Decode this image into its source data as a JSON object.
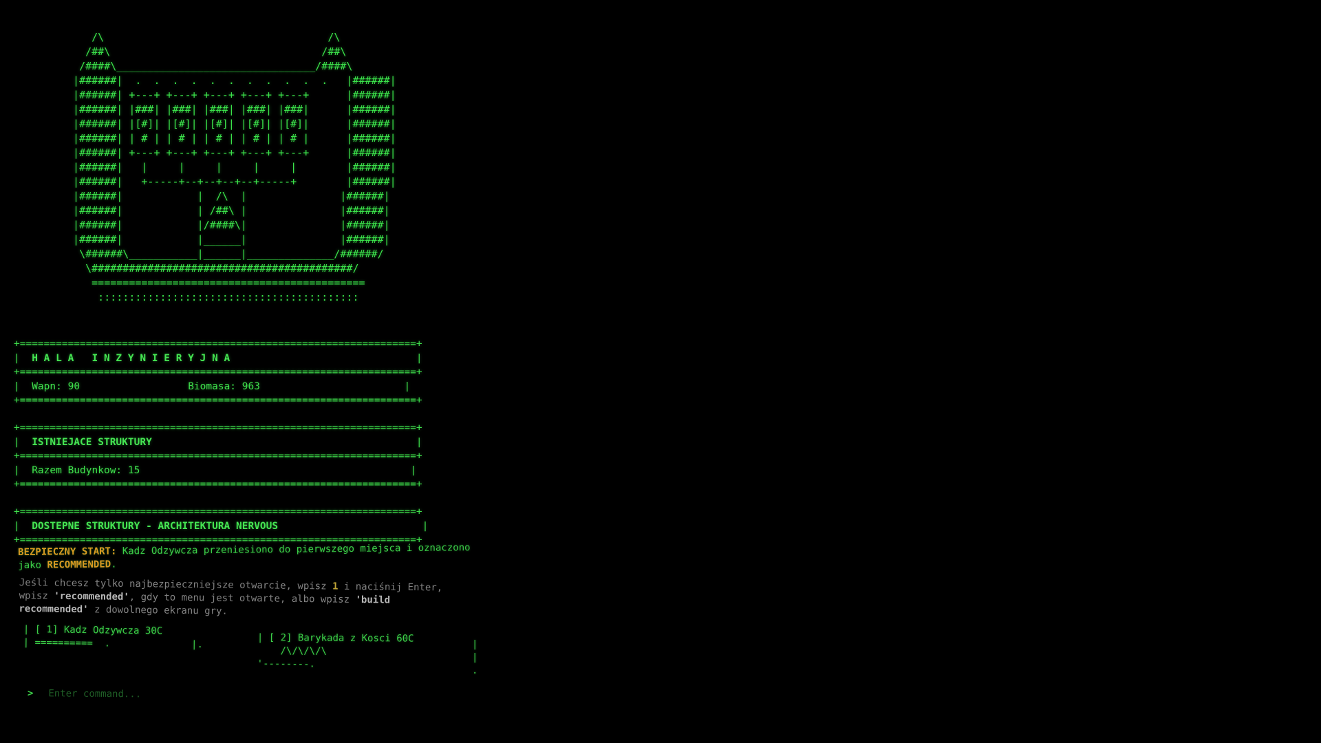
{
  "ascii_art": "     /\\                                    /\\\n    /##\\                                  /##\\\n   /####\\________________________________/####\\\n  |######|  .  .  .  .  .  .  .  .  .  .  .   |######|\n  |######| +---+ +---+ +---+ +---+ +---+      |######|\n  |######| |###| |###| |###| |###| |###|      |######|\n  |######| |[#]| |[#]| |[#]| |[#]| |[#]|      |######|\n  |######| | # | | # | | # | | # | | # |      |######|\n  |######| +---+ +---+ +---+ +---+ +---+      |######|\n  |######|   |     |     |     |     |        |######|\n  |######|   +-----+--+--+--+--+-----+        |######|\n  |######|            |  /\\  |               |######|\n  |######|            | /##\\ |               |######|\n  |######|            |/####\\|               |######|\n  |######|            |______|               |######|\n   \\######\\___________|______|______________/######/\n    \\##########################################/\n     ============================================\n      ::::::::::::::::::::::::::::::::::::::::::",
  "hall": {
    "border": "+==================================================================+",
    "title": "H A L A   I N Z Y N I E R Y J N A",
    "lime_label": "Wapn:",
    "lime_value": "90",
    "biomass_label": "Biomasa:",
    "biomass_value": "963"
  },
  "existing": {
    "title": "ISTNIEJACE STRUKTURY",
    "total_label": "Razem Budynkow:",
    "total_value": "15"
  },
  "available": {
    "title": "DOSTEPNE STRUKTURY - ARCHITEKTURA NERVOUS"
  },
  "safe_start": {
    "label": "BEZPIECZNY START:",
    "text": "Kadz Odzywcza przeniesiono do pierwszego miejsca i oznaczono jako",
    "highlight": "RECOMMENDED",
    "end": "."
  },
  "hint": {
    "part1": "Jeśli chcesz tylko najbezpieczniejsze otwarcie, wpisz",
    "key": "1",
    "part2": "i naciśnij Enter, wpisz",
    "cmd1": "'recommended'",
    "part3": ", gdy to menu jest otwarte, albo wpisz",
    "cmd2": "'build recommended'",
    "part4": "z dowolnego ekranu gry."
  },
  "cards": [
    {
      "label": "[ 1] Kadz Odzywcza 30C",
      "art": "==========  .              |.\n"
    },
    {
      "label": "[ 2] Barykada z Kosci 60C",
      "art": "/\\/\\/\\/\\\n'--------."
    }
  ],
  "command": {
    "prompt": ">",
    "placeholder": "Enter command..."
  },
  "colors": {
    "terminal_green": "#3fe04c",
    "warning_orange": "#d99a22",
    "hint_gray": "#9a9a9a",
    "background": "#000000"
  }
}
